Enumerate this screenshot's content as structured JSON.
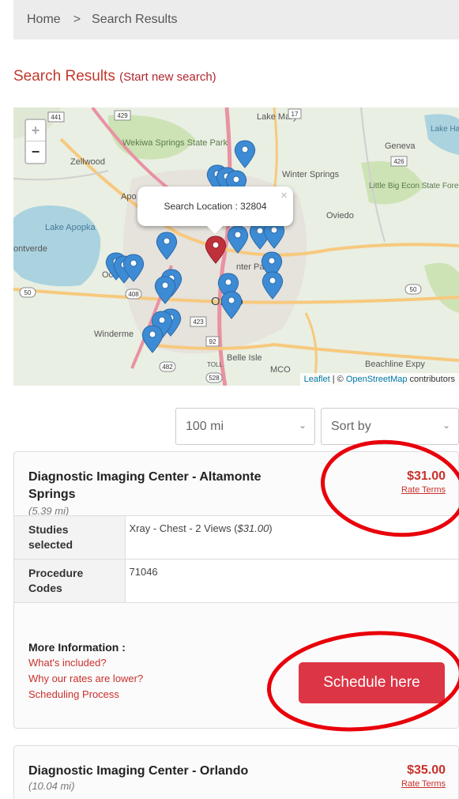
{
  "breadcrumb": {
    "home": "Home",
    "separator": ">",
    "current": "Search Results"
  },
  "header": {
    "title": "Search Results",
    "restart_link": "(Start new search)"
  },
  "map": {
    "zoom_in": "+",
    "zoom_out": "−",
    "popup_text": "Search Location : 32804",
    "popup_close": "×",
    "attribution_leaflet": "Leaflet",
    "attribution_sep": " | © ",
    "attribution_osm": "OpenStreetMap",
    "attribution_suffix": " contributors",
    "place_labels": {
      "lake_mary": "Lake Mary",
      "wekiwa": "Wekiwa Springs State Park",
      "zellwood": "Zellwood",
      "geneva": "Geneva",
      "winter_springs": "Winter Springs",
      "little_big": "Little Big Econ State Forest",
      "oviedo": "Oviedo",
      "lake_apopka": "Lake Apopka",
      "apopka": "Apo",
      "montverde": "ontverde",
      "winter_park": "nter Park",
      "orlando": "Orl do",
      "windermere": "Winderme",
      "belle_isle": "Belle Isle",
      "beachline": "Beachline Expy",
      "lake_harney": "Lake Harney",
      "mco": "MCO",
      "toll": "TOLL",
      "oc": "Oc"
    },
    "road_shields": [
      "441",
      "429",
      "17",
      "426",
      "50",
      "408",
      "423",
      "92",
      "482",
      "528",
      "50"
    ],
    "accent_marker": "#3d8bd4",
    "selected_marker": "#c0303a"
  },
  "filters": {
    "distance": "100 mi",
    "sort": "Sort by"
  },
  "results": [
    {
      "name": "Diagnostic Imaging Center - Altamonte Springs",
      "distance": "(5.39 mi)",
      "price": "$31.00",
      "rate_terms": "Rate Terms",
      "studies_label": "Studies selected",
      "studies_value": "Xray - Chest - 2 Views (",
      "studies_price": "$31.00",
      "studies_close": ")",
      "codes_label": "Procedure Codes",
      "codes_value": "71046",
      "more_info": "More Information :",
      "links": [
        "What's included?",
        "Why our rates are lower?",
        "Scheduling Process"
      ],
      "schedule": "Schedule here"
    },
    {
      "name": "Diagnostic Imaging Center - Orlando",
      "distance": "(10.04 mi)",
      "price": "$35.00",
      "rate_terms": "Rate Terms"
    }
  ],
  "colors": {
    "price": "#c9302c",
    "button": "#dc3545",
    "annotation": "#e8000b",
    "title": "#c0392b"
  }
}
